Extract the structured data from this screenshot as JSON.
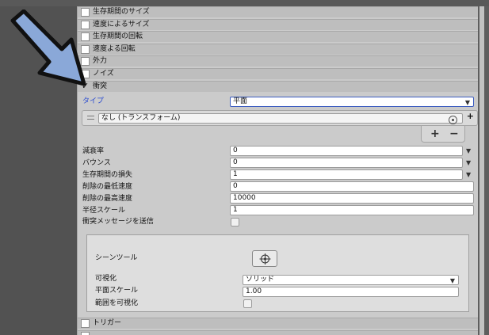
{
  "modules_above": [
    {
      "label": "生存期間のサイズ",
      "checked": false
    },
    {
      "label": "速度によるサイズ",
      "checked": false
    },
    {
      "label": "生存期間の回転",
      "checked": false
    },
    {
      "label": "速度よる回転",
      "checked": false
    },
    {
      "label": "外力",
      "checked": false
    },
    {
      "label": "ノイズ",
      "checked": false
    },
    {
      "label": "衝突",
      "checked": true
    }
  ],
  "collision": {
    "type_label": "タイプ",
    "type_value": "平面",
    "plane_object": "なし (トランスフォーム)",
    "plus_small": "+",
    "add_symbol": "+",
    "remove_symbol": "−",
    "properties": [
      {
        "label": "減衰率",
        "value": "0",
        "has_dropdown": true
      },
      {
        "label": "バウンス",
        "value": "0",
        "has_dropdown": true
      },
      {
        "label": "生存期間の損失",
        "value": "1",
        "has_dropdown": true
      },
      {
        "label": "削除の最低速度",
        "value": "0",
        "has_dropdown": false
      },
      {
        "label": "削除の最高速度",
        "value": "10000",
        "has_dropdown": false
      },
      {
        "label": "半径スケール",
        "value": "1",
        "has_dropdown": false
      }
    ],
    "send_messages_label": "衝突メッセージを送信",
    "send_messages_checked": false,
    "scene_tool": {
      "scene_tool_label": "シーンツール",
      "visualize_label": "可視化",
      "visualize_value": "ソリッド",
      "plane_scale_label": "平面スケール",
      "plane_scale_value": "1.00",
      "visualize_bounds_label": "範囲を可視化",
      "visualize_bounds_checked": false
    }
  },
  "modules_below": [
    {
      "label": "トリガー",
      "checked": false
    }
  ],
  "colors": {
    "accent_type_label": "#2a4bd0",
    "arrow_fill": "#8aa8d8"
  }
}
